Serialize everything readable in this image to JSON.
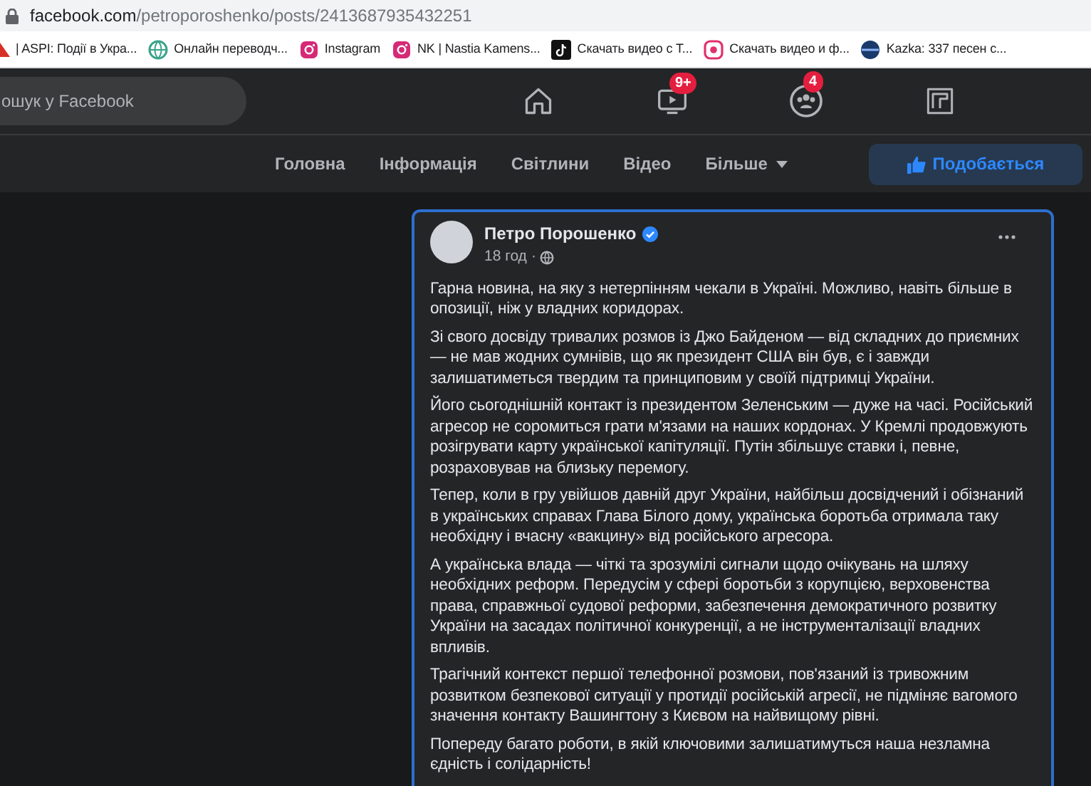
{
  "browser": {
    "url_host": "facebook.com",
    "url_path": "/petroporoshenko/posts/2413687935432251"
  },
  "bookmarks": [
    {
      "label": "| ASPI: Події в Укра...",
      "kind": "pdf"
    },
    {
      "label": "Онлайн переводч...",
      "kind": "globe"
    },
    {
      "label": "Instagram",
      "kind": "instagram"
    },
    {
      "label": "NK | Nastia Kamens...",
      "kind": "instagram"
    },
    {
      "label": "Скачать видео с Т...",
      "kind": "tiktok"
    },
    {
      "label": "Скачать видео и ф...",
      "kind": "download"
    },
    {
      "label": "Kazka: 337 песен с...",
      "kind": "disc"
    }
  ],
  "topbar": {
    "search": {
      "placeholder": "ошук у Facebook"
    },
    "nav": [
      {
        "kind": "home"
      },
      {
        "kind": "video",
        "badge": "9+"
      },
      {
        "kind": "groups",
        "badge": "4"
      },
      {
        "kind": "gaming"
      }
    ]
  },
  "page_tabs": [
    {
      "label": "Головна",
      "caret": false
    },
    {
      "label": "Інформація",
      "caret": false
    },
    {
      "label": "Світлини",
      "caret": false
    },
    {
      "label": "Відео",
      "caret": false
    },
    {
      "label": "Більше",
      "caret": true
    }
  ],
  "like_button": {
    "label": "Подобається"
  },
  "post": {
    "author": "Петро Порошенко",
    "verified": true,
    "time": "18 год",
    "separator": "·",
    "paragraphs": [
      "Гарна новина, на яку з нетерпінням чекали в Україні. Можливо, навіть більше в опозиції, ніж у владних коридорах.",
      "Зі свого досвіду тривалих розмов із Джо Байденом — від складних до приємних — не мав жодних сумнівів, що як президент США він був, є і завжди залишатиметься твердим та принциповим у своїй підтримці України.",
      "Його сьогоднішній контакт із президентом Зеленським — дуже на часі. Російський агресор не соромиться грати м'язами на наших кордонах. У Кремлі продовжують розігрувати карту української капітуляції. Путін збільшує ставки і, певне, розраховував на близьку перемогу.",
      "Тепер, коли в гру увійшов давній друг України, найбільш досвідчений і обізнаний в українських справах Глава Білого дому, українська боротьба отримала таку необхідну і вчасну «вакцину» від російського агресора.",
      "А українська влада — чіткі та зрозумілі сигнали щодо очікувань на шляху необхідних реформ. Передусім у сфері боротьби з корупцією, верховенства права, справжньої судової реформи, забезпечення демократичного розвитку України на засадах політичної конкуренції, а не інструменталізації владних впливів.",
      "Трагічний контекст першої телефонної розмови, пов'язаний із тривожним розвитком безпекової ситуації у протидії російській агресії, не підміняє вагомого значення контакту Вашингтону з Києвом на найвищому рівні.",
      "Попереду багато роботи, в якій ключовими залишатимуться наша незламна єдність і солідарність!"
    ]
  }
}
